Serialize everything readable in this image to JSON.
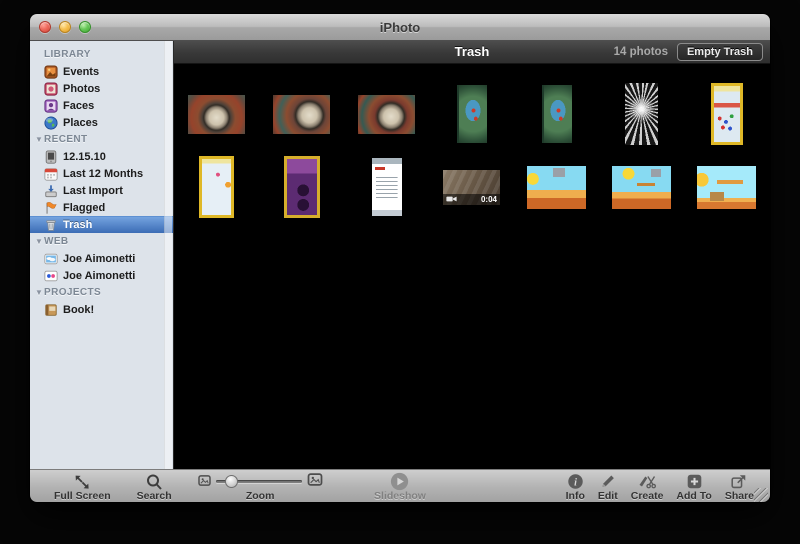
{
  "colors": {
    "selection_blue": "#3b6cb5",
    "header_dark": "#383838",
    "sidebar_bg": "#dde3ea"
  },
  "window": {
    "title": "iPhoto",
    "controls": [
      {
        "name": "close",
        "color": "red"
      },
      {
        "name": "minimize",
        "color": "yellow"
      },
      {
        "name": "zoom",
        "color": "green"
      }
    ]
  },
  "sidebar": {
    "sections": [
      {
        "label": "LIBRARY",
        "disclosure": false,
        "items": [
          {
            "name": "events",
            "label": "Events",
            "icon": "events-icon"
          },
          {
            "name": "photos",
            "label": "Photos",
            "icon": "photos-icon"
          },
          {
            "name": "faces",
            "label": "Faces",
            "icon": "faces-icon"
          },
          {
            "name": "places",
            "label": "Places",
            "icon": "places-icon"
          }
        ]
      },
      {
        "label": "RECENT",
        "disclosure": true,
        "items": [
          {
            "name": "dec-15-10",
            "label": "12.15.10",
            "icon": "device-icon"
          },
          {
            "name": "last-12-months",
            "label": "Last 12 Months",
            "icon": "calendar-icon"
          },
          {
            "name": "last-import",
            "label": "Last Import",
            "icon": "import-icon"
          },
          {
            "name": "flagged",
            "label": "Flagged",
            "icon": "flag-icon"
          },
          {
            "name": "trash",
            "label": "Trash",
            "icon": "trash-icon",
            "selected": true
          }
        ]
      },
      {
        "label": "WEB",
        "disclosure": true,
        "items": [
          {
            "name": "web-gallery-joe-aimonetti",
            "label": "Joe Aimonetti",
            "icon": "web-gallery-icon"
          },
          {
            "name": "flickr-joe-aimonetti",
            "label": "Joe Aimonetti",
            "icon": "flickr-icon"
          }
        ]
      },
      {
        "label": "PROJECTS",
        "disclosure": true,
        "items": [
          {
            "name": "book",
            "label": "Book!",
            "icon": "book-icon"
          }
        ]
      }
    ]
  },
  "header": {
    "title": "Trash",
    "count_label": "14 photos",
    "empty_trash_label": "Empty Trash"
  },
  "photos": [
    {
      "name": "pinball-arena-screenshot-1",
      "kind": "arena",
      "orientation": "landscape"
    },
    {
      "name": "pinball-arena-screenshot-2",
      "kind": "arena2",
      "orientation": "landscape"
    },
    {
      "name": "pinball-arena-screenshot-3",
      "kind": "arena3",
      "orientation": "landscape"
    },
    {
      "name": "golf-course-map-screenshot-1",
      "kind": "map",
      "orientation": "portrait"
    },
    {
      "name": "golf-course-map-screenshot-2",
      "kind": "map",
      "orientation": "portrait"
    },
    {
      "name": "black-white-abstract-photo",
      "kind": "bw",
      "orientation": "portrait"
    },
    {
      "name": "puzzle-game-final-wave-screenshot",
      "kind": "puzzle-busy",
      "orientation": "portrait"
    },
    {
      "name": "puzzle-game-board-screenshot",
      "kind": "puzzle-light",
      "orientation": "portrait"
    },
    {
      "name": "game-over-screenshot",
      "kind": "gameover",
      "orientation": "portrait"
    },
    {
      "name": "move-the-ball-instructions-screenshot",
      "kind": "textpage",
      "orientation": "portrait"
    },
    {
      "name": "video-clip-wood-floor",
      "kind": "video",
      "orientation": "landscape",
      "duration": "0:04"
    },
    {
      "name": "cartoon-game-screenshot-1",
      "kind": "cartoon",
      "orientation": "landscape"
    },
    {
      "name": "cartoon-game-screenshot-2",
      "kind": "cartoon2",
      "orientation": "landscape"
    },
    {
      "name": "cartoon-game-screenshot-3",
      "kind": "cartoon3",
      "orientation": "landscape"
    }
  ],
  "toolbar": {
    "left": [
      {
        "name": "full-screen",
        "label": "Full Screen",
        "icon": "fullscreen-icon"
      },
      {
        "name": "search",
        "label": "Search",
        "icon": "search-icon"
      },
      {
        "name": "zoom",
        "label": "Zoom",
        "type": "slider",
        "slider_position": 0.12
      }
    ],
    "center": [
      {
        "name": "slideshow",
        "label": "Slideshow",
        "icon": "play-circle-icon",
        "disabled": true
      }
    ],
    "right": [
      {
        "name": "info",
        "label": "Info",
        "icon": "info-icon"
      },
      {
        "name": "edit",
        "label": "Edit",
        "icon": "edit-pencil-icon"
      },
      {
        "name": "create",
        "label": "Create",
        "icon": "create-icon"
      },
      {
        "name": "add-to",
        "label": "Add To",
        "icon": "add-to-icon"
      },
      {
        "name": "share",
        "label": "Share",
        "icon": "share-icon"
      }
    ]
  }
}
